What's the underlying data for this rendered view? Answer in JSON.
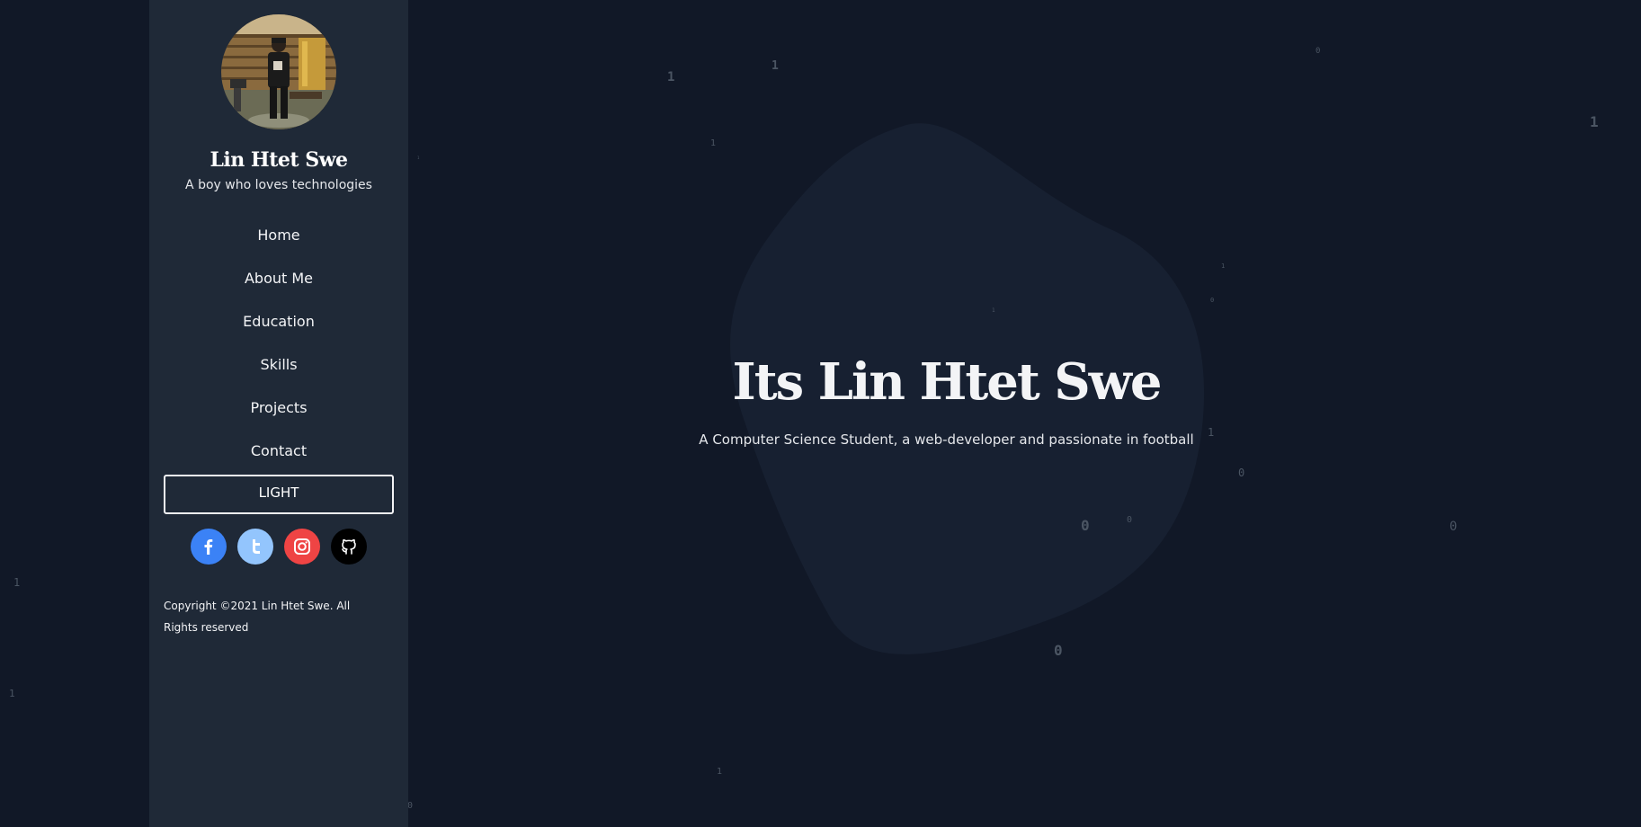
{
  "sidebar": {
    "profile_name": "Lin Htet Swe",
    "tagline": "A boy who loves technologies",
    "nav_items": [
      {
        "label": "Home"
      },
      {
        "label": "About Me"
      },
      {
        "label": "Education"
      },
      {
        "label": "Skills"
      },
      {
        "label": "Projects"
      },
      {
        "label": "Contact"
      }
    ],
    "theme_button_label": "LIGHT",
    "socials": [
      {
        "name": "facebook",
        "icon": "facebook-icon",
        "color": "#3b82f6"
      },
      {
        "name": "twitter",
        "icon": "twitter-icon",
        "color": "#93c5fd"
      },
      {
        "name": "instagram",
        "icon": "instagram-icon",
        "color": "#ef4444"
      },
      {
        "name": "github",
        "icon": "github-icon",
        "color": "#000000"
      }
    ],
    "copyright": "Copyright ©2021 Lin Htet Swe. All Rights reserved"
  },
  "hero": {
    "title": "Its Lin Htet Swe",
    "subtitle": "A Computer Science Student, a web-developer and passionate in football"
  },
  "background": {
    "digits": [
      "1",
      "1",
      "1",
      "1",
      "1",
      "1",
      "1",
      "1",
      "1",
      "1",
      "1",
      "0",
      "0",
      "0",
      "0",
      "0",
      "0",
      "0",
      "0"
    ]
  },
  "colors": {
    "page_background": "#111827",
    "sidebar_background": "#1f2937",
    "blob": "#172031",
    "text": "#f3f4f6"
  }
}
